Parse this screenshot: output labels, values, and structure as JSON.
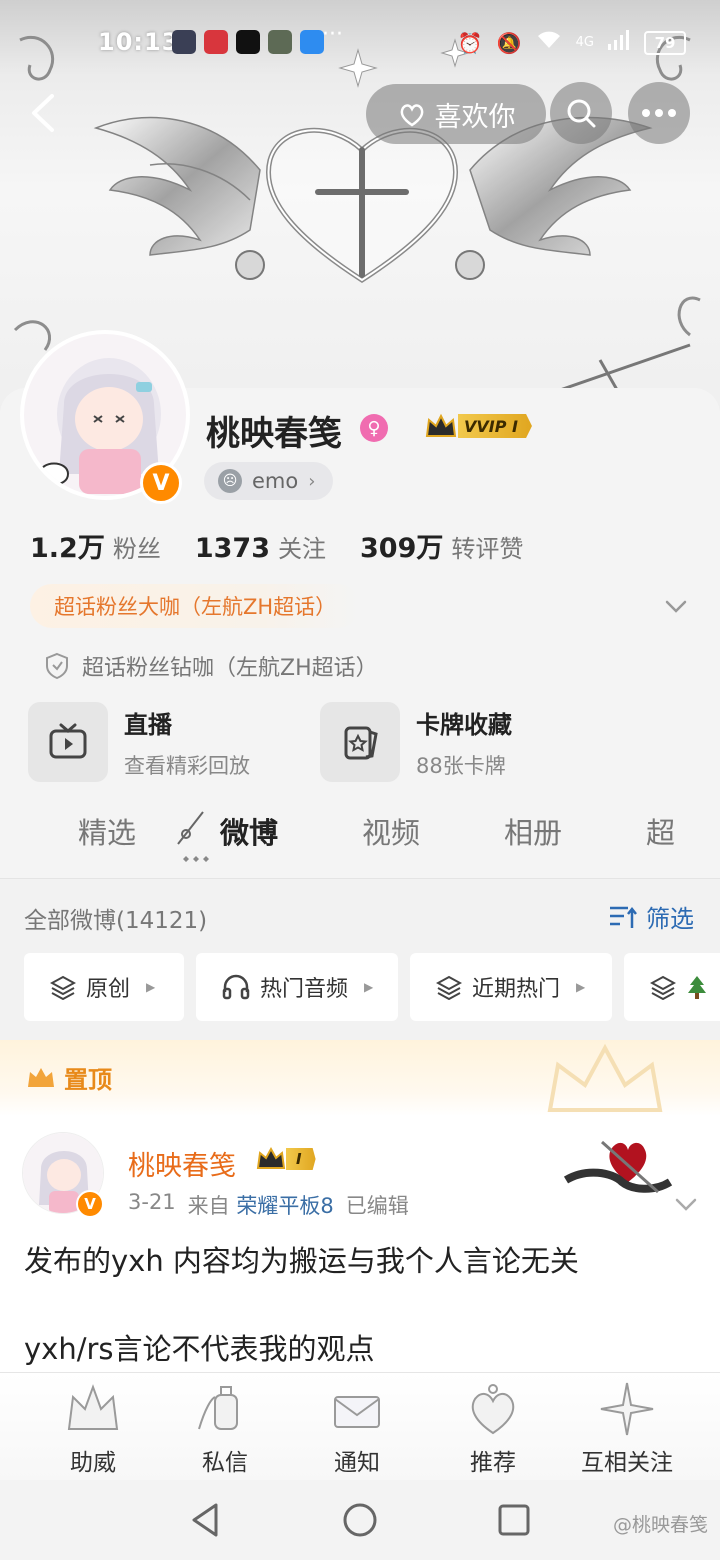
{
  "status_bar": {
    "time": "10:13",
    "battery": "79",
    "network": "4G"
  },
  "header": {
    "like_label": "喜欢你"
  },
  "profile": {
    "name": "桃映春笺",
    "vip_tag": "VVIP I",
    "mood": "emo",
    "stats": [
      {
        "num": "1.2万",
        "label": "粉丝"
      },
      {
        "num": "1373",
        "label": "关注"
      },
      {
        "num": "309万",
        "label": "转评赞"
      }
    ],
    "fan_tag_primary": "超话粉丝大咖（左航ZH超话）",
    "fan_tag_secondary": "超话粉丝钻咖（左航ZH超话）"
  },
  "features": [
    {
      "title": "直播",
      "subtitle": "查看精彩回放"
    },
    {
      "title": "卡牌收藏",
      "subtitle": "88张卡牌"
    }
  ],
  "tabs": [
    "精选",
    "微博",
    "视频",
    "相册",
    "超"
  ],
  "feed": {
    "count_label": "全部微博(14121)",
    "filter_label": "筛选",
    "chips": [
      "原创",
      "热门音频",
      "近期热门"
    ]
  },
  "pinned_post": {
    "pin_label": "置顶",
    "author": "桃映春笺",
    "vip_tag": "I",
    "date": "3-21",
    "from_prefix": "来自",
    "source": "荣耀平板8",
    "edited": "已编辑",
    "line1": "发布的yxh 内容均为搬运与我个人言论无关",
    "line2": "yxh/rs言论不代表我的观点"
  },
  "bottom_bar": [
    "助威",
    "私信",
    "通知",
    "推荐",
    "互相关注"
  ],
  "watermark": "@桃映春笺",
  "colors": {
    "orange": "#e86c1a",
    "blue": "#2d6bb3",
    "gold": "#e0a620",
    "pink": "#f06cb0"
  }
}
